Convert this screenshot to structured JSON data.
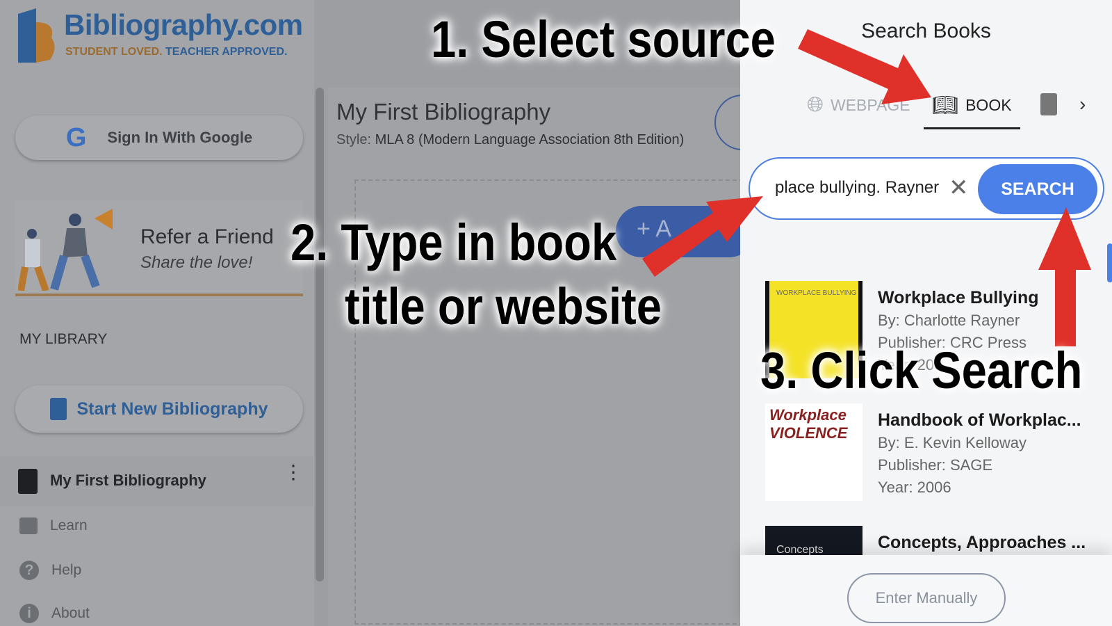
{
  "logo": {
    "title": "Bibliography.com",
    "tag_part1": "STUDENT LOVED.",
    "tag_part2": "TEACHER APPROVED."
  },
  "sidebar": {
    "google_btn": "Sign In With Google",
    "refer": {
      "title": "Refer a Friend",
      "subtitle": "Share the love!"
    },
    "library_heading": "MY LIBRARY",
    "new_btn": "Start New Bibliography",
    "bibliography_item": "My First Bibliography",
    "nav": [
      {
        "label": "Learn",
        "icon": "book-reader-icon"
      },
      {
        "label": "Help",
        "icon": "question-icon"
      },
      {
        "label": "About",
        "icon": "info-icon"
      }
    ]
  },
  "main": {
    "title": "My First Bibliography",
    "style_label": "Style:",
    "style_value": "MLA 8 (Modern Language Association 8th Edition)",
    "add_btn": "+ A"
  },
  "panel": {
    "title": "Search Books",
    "tabs": [
      {
        "label": "WEBPAGE",
        "icon": "globe-icon",
        "active": false
      },
      {
        "label": "BOOK",
        "icon": "book-icon",
        "active": true
      },
      {
        "label": "",
        "icon": "document-icon",
        "active": false
      }
    ],
    "search_value": "place bullying. Rayner",
    "search_btn": "SEARCH",
    "results": [
      {
        "title": "Workplace Bullying",
        "by": "By: Charlotte Rayner",
        "publisher": "Publisher: CRC Press",
        "year": "Year: 200",
        "cover_text": "WORKPLACE BULLYING"
      },
      {
        "title": "Handbook of Workplac...",
        "by": "By: E. Kevin Kelloway",
        "publisher": "Publisher: SAGE",
        "year": "Year: 2006",
        "cover_text": "Workplace VIOLENCE"
      },
      {
        "title": "Concepts, Approaches ...",
        "cover_text": "Concepts"
      }
    ],
    "enter_manually": "Enter Manually"
  },
  "annotations": {
    "step1": "1. Select source",
    "step2a": "2. Type in book",
    "step2b": "title or website",
    "step3": "3. Click Search"
  },
  "colors": {
    "accent": "#4a80e8",
    "arrow": "#e0302a",
    "brand_blue": "#2f5f97",
    "brand_orange": "#c8822e"
  }
}
